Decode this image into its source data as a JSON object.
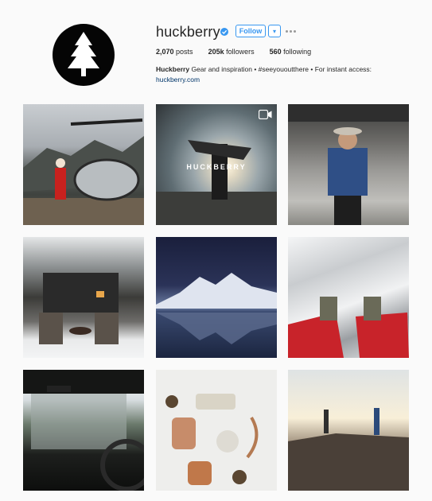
{
  "profile": {
    "username": "huckberry",
    "follow_label": "Follow",
    "caret_label": "▾",
    "stats": {
      "posts_count": "2,070",
      "posts_label": "posts",
      "followers_count": "205k",
      "followers_label": "followers",
      "following_count": "560",
      "following_label": "following"
    },
    "bio": {
      "name": "Huckberry",
      "text": "Gear and inspiration • #seeyououtthere • For instant access:",
      "link": "huckberry.com"
    }
  },
  "watermark": "HUCKBERRY",
  "posts": [
    {
      "icon": "helicopter-santa-photo"
    },
    {
      "icon": "sunset-rock-video"
    },
    {
      "icon": "man-denim-street-photo"
    },
    {
      "icon": "cabin-snow-chairs-photo"
    },
    {
      "icon": "mountain-lake-photo"
    },
    {
      "icon": "snow-boots-photo"
    },
    {
      "icon": "truck-window-photo"
    },
    {
      "icon": "product-flatlay-photo"
    },
    {
      "icon": "cliff-hikers-photo"
    }
  ],
  "colors": {
    "accent": "#3897f0",
    "background": "#fafafa",
    "text": "#262626",
    "link": "#003569"
  }
}
